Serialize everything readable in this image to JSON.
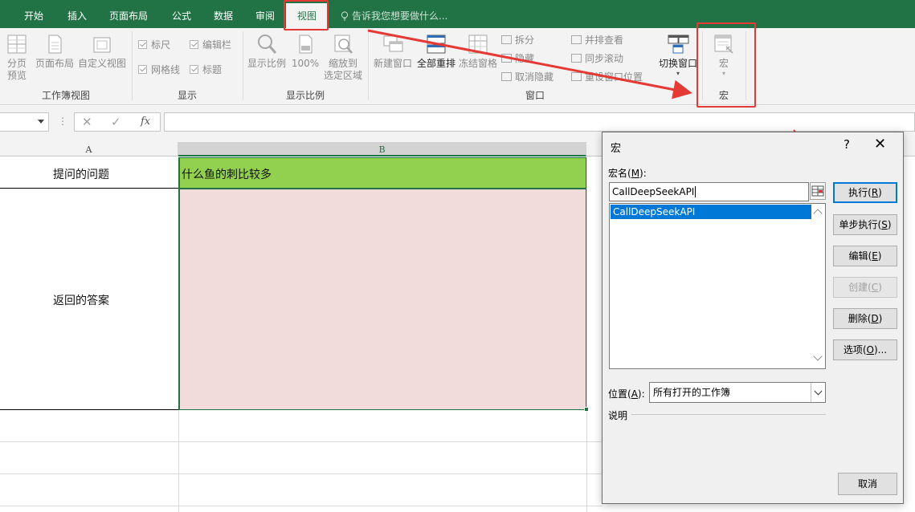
{
  "ribbon_tabs": [
    "开始",
    "插入",
    "页面布局",
    "公式",
    "数据",
    "审阅",
    "视图"
  ],
  "active_tab": "视图",
  "tell_me_placeholder": "告诉我您想要做什么...",
  "groups": {
    "workbook_views": {
      "label": "工作簿视图",
      "buttons": [
        "分页\n预览",
        "页面布局",
        "自定义视图"
      ]
    },
    "show": {
      "label": "显示",
      "checks": [
        "标尺",
        "编辑栏",
        "网格线",
        "标题"
      ]
    },
    "zoom": {
      "label": "显示比例",
      "buttons": [
        "显示比例",
        "100%",
        "缩放到\n选定区域"
      ]
    },
    "window": {
      "label": "窗口",
      "buttons": [
        "新建窗口",
        "全部重排",
        "冻结窗格"
      ],
      "small": [
        "拆分",
        "隐藏",
        "取消隐藏",
        "并排查看",
        "同步滚动",
        "重设窗口位置"
      ],
      "switch": "切换窗口"
    },
    "macros": {
      "label": "宏",
      "button": "宏"
    }
  },
  "formula_bar": {
    "cancel": "✕",
    "enter": "✓",
    "fx": "fx",
    "value": ""
  },
  "columns": [
    "A",
    "B"
  ],
  "cells": {
    "a1": "提问的问题",
    "b1": "什么鱼的刺比较多",
    "a2": "返回的答案",
    "b2": ""
  },
  "colors": {
    "excel_green": "#217346",
    "b1_fill": "#92d050",
    "b2_fill": "#f2dcdb",
    "annotation_red": "#e53935"
  },
  "dialog": {
    "title": "宏",
    "help": "?",
    "close": "✕",
    "macro_name_label": "宏名(",
    "macro_name_key": "M",
    "macro_name_label_end": "):",
    "macro_name_value": "CallDeepSeekAPI",
    "macro_list": [
      "CallDeepSeekAPI"
    ],
    "location_label": "位置(",
    "location_key": "A",
    "location_label_end": "):",
    "location_value": "所有打开的工作簿",
    "description_label": "说明",
    "buttons": [
      {
        "pre": "执行(",
        "key": "R",
        "post": ")"
      },
      {
        "pre": "单步执行(",
        "key": "S",
        "post": ")"
      },
      {
        "pre": "编辑(",
        "key": "E",
        "post": ")"
      },
      {
        "pre": "创建(",
        "key": "C",
        "post": ")"
      },
      {
        "pre": "删除(",
        "key": "D",
        "post": ")"
      },
      {
        "pre": "选项(",
        "key": "O",
        "post": ")..."
      }
    ],
    "cancel": "取消"
  }
}
